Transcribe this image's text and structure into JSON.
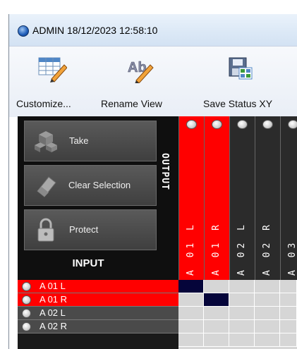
{
  "window": {
    "title": "ADMIN 18/12/2023 12:58:10"
  },
  "toolbar": {
    "buttons": [
      {
        "label": "Customize...",
        "icon": "customize-grid-icon"
      },
      {
        "label": "Rename View",
        "icon": "rename-ab-icon"
      },
      {
        "label": "Save Status XY",
        "icon": "save-status-icon"
      }
    ]
  },
  "commands": {
    "take": "Take",
    "clear_selection": "Clear Selection",
    "protect": "Protect"
  },
  "labels": {
    "output": "OUTPUT",
    "input": "INPUT"
  },
  "colors": {
    "selected": "#ff0000",
    "crosspoint": "#05053a",
    "panel": "#0f0f0f"
  },
  "outputs": [
    {
      "label": "A 01 L",
      "selected": true
    },
    {
      "label": "A 01 R",
      "selected": true
    },
    {
      "label": "A 02 L",
      "selected": false
    },
    {
      "label": "A 02 R",
      "selected": false
    },
    {
      "label": "A 03",
      "selected": false
    }
  ],
  "inputs": [
    {
      "label": "A 01 L",
      "selected": true
    },
    {
      "label": "A 01 R",
      "selected": true
    },
    {
      "label": "A 02 L",
      "selected": false
    },
    {
      "label": "A 02 R",
      "selected": false
    }
  ],
  "crosspoints": [
    {
      "input": 0,
      "output": 0
    },
    {
      "input": 1,
      "output": 1
    }
  ]
}
